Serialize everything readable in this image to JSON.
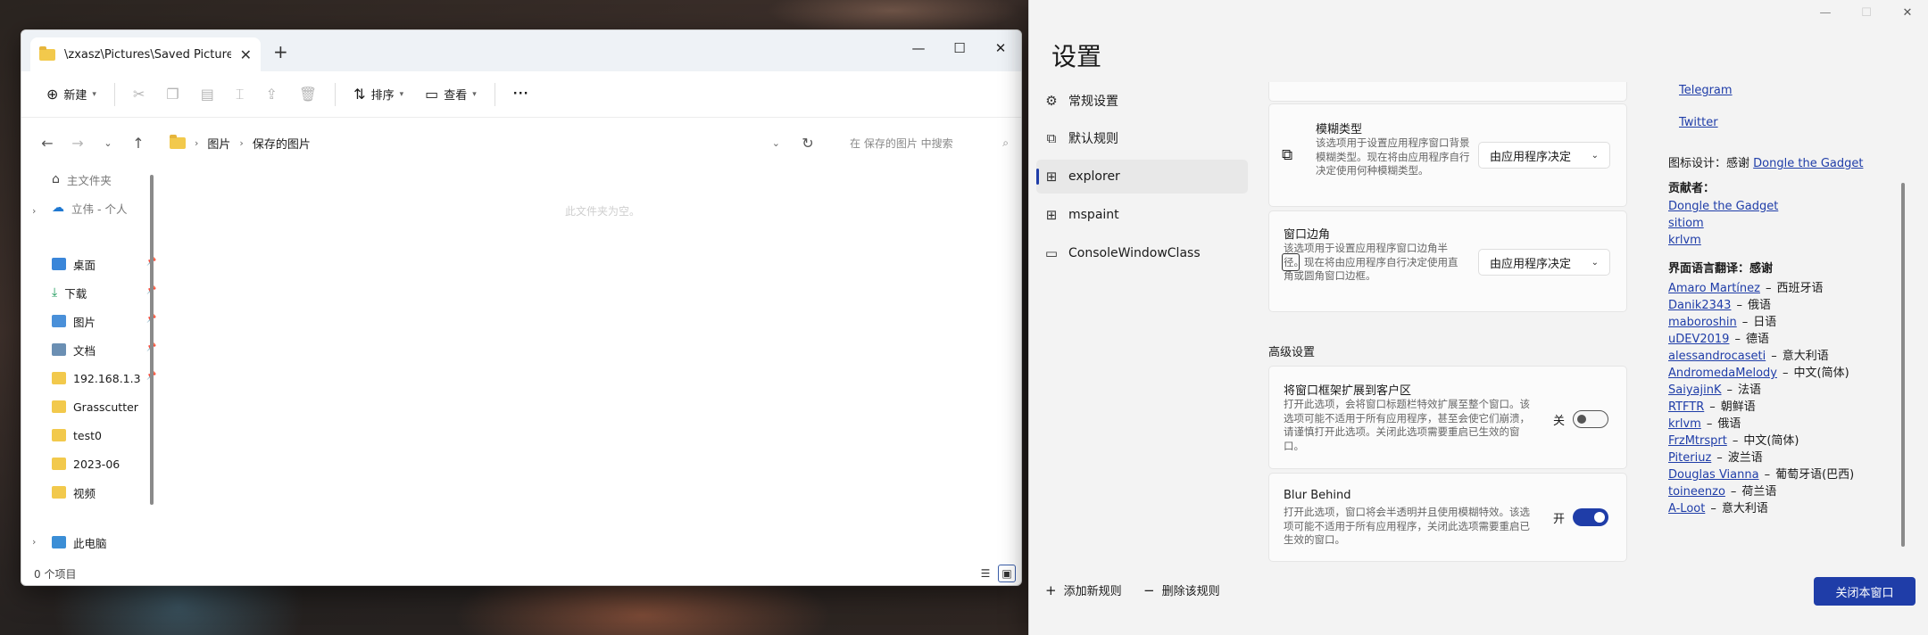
{
  "explorer": {
    "tab_title": "\\zxasz\\Pictures\\Saved Pictures",
    "toolbar": {
      "new_label": "新建",
      "sort_label": "排序",
      "view_label": "查看",
      "more_label": "···"
    },
    "breadcrumb": [
      "图片",
      "保存的图片"
    ],
    "search_placeholder": "在 保存的图片 中搜索",
    "nav_items": [
      {
        "label": "主文件夹",
        "icon": "home-icon"
      },
      {
        "label": "立伟 - 个人",
        "icon": "cloud-icon"
      },
      {
        "label": "桌面",
        "icon": "desktop-icon",
        "pinned": true
      },
      {
        "label": "下载",
        "icon": "download-icon",
        "pinned": true
      },
      {
        "label": "图片",
        "icon": "pictures-icon",
        "pinned": true
      },
      {
        "label": "文档",
        "icon": "documents-icon",
        "pinned": true
      },
      {
        "label": "192.168.1.3",
        "icon": "network-folder-icon",
        "pinned": true
      },
      {
        "label": "Grasscutter",
        "icon": "folder-icon"
      },
      {
        "label": "test0",
        "icon": "folder-icon"
      },
      {
        "label": "2023-06",
        "icon": "folder-icon"
      },
      {
        "label": "视频",
        "icon": "folder-icon"
      },
      {
        "label": "此电脑",
        "icon": "pc-icon"
      }
    ],
    "empty_message": "此文件夹为空。",
    "status": "0 个项目",
    "colors": {
      "accent": "#3b5ea8",
      "folder": "#f2c94c"
    }
  },
  "settings": {
    "title": "设置",
    "nav": [
      {
        "label": "常规设置",
        "icon": "gear-icon"
      },
      {
        "label": "默认规则",
        "icon": "rules-icon"
      },
      {
        "label": "explorer",
        "icon": "window-rule-icon",
        "active": true
      },
      {
        "label": "mspaint",
        "icon": "window-rule-icon"
      },
      {
        "label": "ConsoleWindowClass",
        "icon": "window-icon"
      }
    ],
    "blur_type": {
      "title": "模糊类型",
      "desc": "该选项用于设置应用程序窗口背景模糊类型。现在将由应用程序自行决定使用何种模糊类型。",
      "value": "由应用程序决定"
    },
    "corner": {
      "title": "窗口边角",
      "desc": "该选项用于设置应用程序窗口边角半径。现在将由应用程序自行决定使用直角或圆角窗口边框。",
      "value": "由应用程序决定"
    },
    "advanced_header": "高级设置",
    "extend_frame": {
      "title": "将窗口框架扩展到客户区",
      "desc": "打开此选项，会将窗口标题栏特效扩展至整个窗口。该选项可能不适用于所有应用程序，甚至会使它们崩溃，请谨慎打开此选项。关闭此选项需要重启已生效的窗口。",
      "state_label": "关",
      "on": false
    },
    "blur_behind": {
      "title": "Blur Behind",
      "desc": "打开此选项，窗口将会半透明并且使用模糊特效。该选项可能不适用于所有应用程序，关闭此选项需要重启已生效的窗口。",
      "state_label": "开",
      "on": true
    },
    "about": {
      "links_top": [
        "Telegram",
        "Twitter"
      ],
      "icon_design_prefix": "图标设计：感谢",
      "icon_designer": "Dongle the Gadget",
      "contributors_title": "贡献者：",
      "contributors": [
        "Dongle the Gadget",
        "sitiom",
        "krlvm"
      ],
      "translators_title": "界面语言翻译：感谢",
      "translators": [
        {
          "name": "Amaro Martínez",
          "lang": "西班牙语"
        },
        {
          "name": "Danik2343",
          "lang": "俄语"
        },
        {
          "name": "maboroshin",
          "lang": "日语"
        },
        {
          "name": "uDEV2019",
          "lang": "德语"
        },
        {
          "name": "alessandrocaseti",
          "lang": "意大利语"
        },
        {
          "name": "AndromedaMelody",
          "lang": "中文(简体)"
        },
        {
          "name": "SaiyajinK",
          "lang": "法语"
        },
        {
          "name": "RTFTR",
          "lang": "朝鲜语"
        },
        {
          "name": "krlvm",
          "lang": "俄语"
        },
        {
          "name": "FrzMtrsprt",
          "lang": "中文(简体)"
        },
        {
          "name": "Piteriuz",
          "lang": "波兰语"
        },
        {
          "name": "Douglas Vianna",
          "lang": "葡萄牙语(巴西)"
        },
        {
          "name": "toineenzo",
          "lang": "荷兰语"
        },
        {
          "name": "A-Loot",
          "lang": "意大利语"
        }
      ],
      "dash": "–"
    },
    "add_rule_label": "添加新规则",
    "delete_rule_label": "删除该规则",
    "close_window_label": "关闭本窗口",
    "colors": {
      "accent": "#1f3da8",
      "link": "#1f3da8"
    }
  }
}
